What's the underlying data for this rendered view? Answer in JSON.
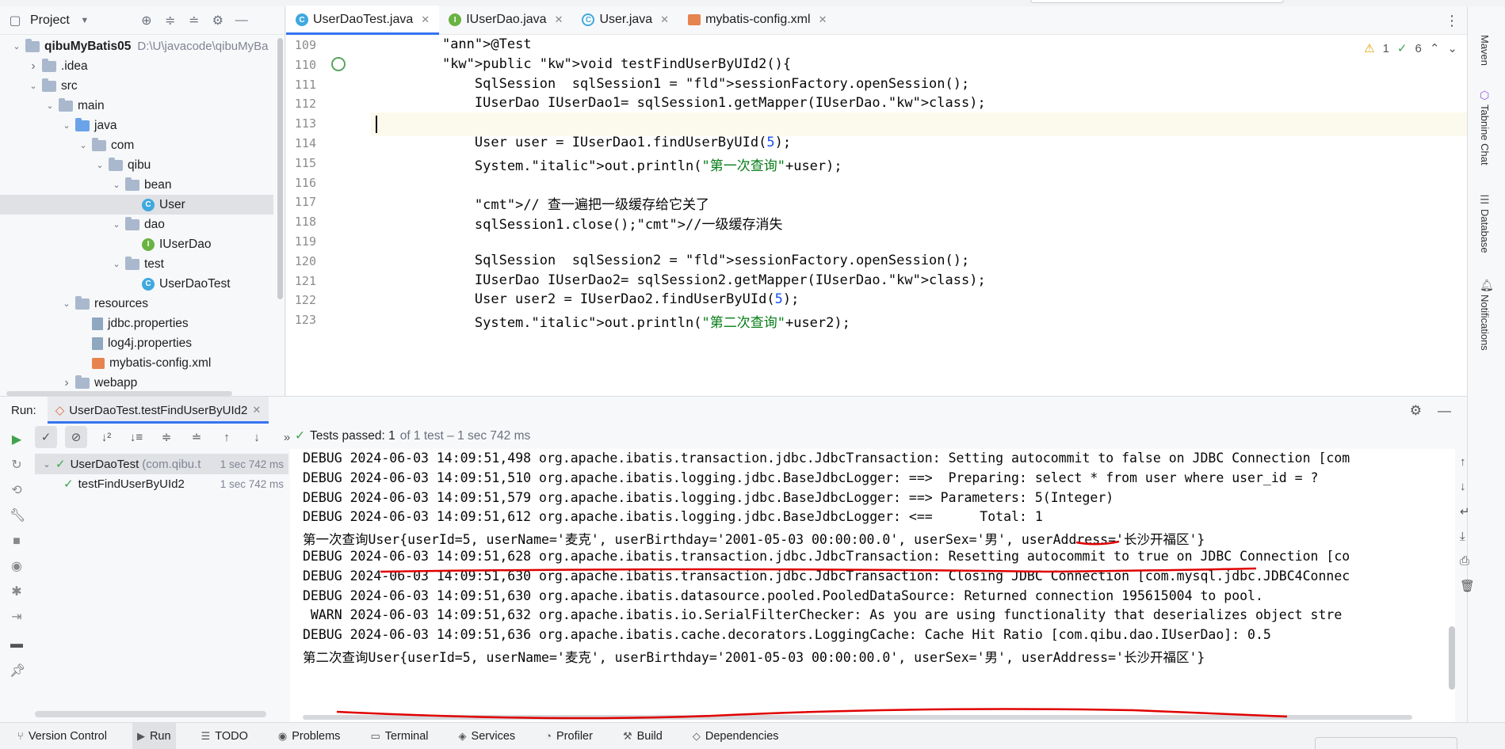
{
  "project": {
    "title": "Project",
    "tree": [
      {
        "label": "qibuMyBatis05",
        "path": "D:\\U\\javacode\\qibuMyBa",
        "icon": "module",
        "depth": 0,
        "open": true
      },
      {
        "label": ".idea",
        "icon": "folder",
        "depth": 1,
        "open": false
      },
      {
        "label": "src",
        "icon": "folder",
        "depth": 1,
        "open": true
      },
      {
        "label": "main",
        "icon": "folder",
        "depth": 2,
        "open": true
      },
      {
        "label": "java",
        "icon": "source-folder",
        "depth": 3,
        "open": true
      },
      {
        "label": "com",
        "icon": "package",
        "depth": 4,
        "open": true
      },
      {
        "label": "qibu",
        "icon": "package",
        "depth": 5,
        "open": true
      },
      {
        "label": "bean",
        "icon": "package",
        "depth": 6,
        "open": true
      },
      {
        "label": "User",
        "icon": "class",
        "depth": 7
      },
      {
        "label": "dao",
        "icon": "package",
        "depth": 6,
        "open": true
      },
      {
        "label": "IUserDao",
        "icon": "interface",
        "depth": 7
      },
      {
        "label": "test",
        "icon": "package",
        "depth": 6,
        "open": true
      },
      {
        "label": "UserDaoTest",
        "icon": "test-class",
        "depth": 7
      },
      {
        "label": "resources",
        "icon": "resources-folder",
        "depth": 3,
        "open": true
      },
      {
        "label": "jdbc.properties",
        "icon": "properties",
        "depth": 4
      },
      {
        "label": "log4j.properties",
        "icon": "properties",
        "depth": 4
      },
      {
        "label": "mybatis-config.xml",
        "icon": "xml",
        "depth": 4
      },
      {
        "label": "webapp",
        "icon": "folder",
        "depth": 3,
        "open": false
      }
    ]
  },
  "editor": {
    "tabs": [
      {
        "label": "UserDaoTest.java",
        "icon": "test-class",
        "active": true
      },
      {
        "label": "IUserDao.java",
        "icon": "interface",
        "active": false
      },
      {
        "label": "User.java",
        "icon": "class",
        "active": false
      },
      {
        "label": "mybatis-config.xml",
        "icon": "xml",
        "active": false
      }
    ],
    "warnings": "1",
    "checks": "6",
    "lines": [
      {
        "n": "109",
        "code": "    @Test"
      },
      {
        "n": "110",
        "code": "    public void testFindUserByUId2(){"
      },
      {
        "n": "111",
        "code": "        SqlSession  sqlSession1 = sessionFactory.openSession();"
      },
      {
        "n": "112",
        "code": "        IUserDao IUserDao1= sqlSession1.getMapper(IUserDao.class);"
      },
      {
        "n": "113",
        "code": ""
      },
      {
        "n": "114",
        "code": "        User user = IUserDao1.findUserByUId(5);"
      },
      {
        "n": "115",
        "code": "        System.out.println(\"第一次查询\"+user);"
      },
      {
        "n": "116",
        "code": ""
      },
      {
        "n": "117",
        "code": "        // 查一遍把一级缓存给它关了"
      },
      {
        "n": "118",
        "code": "        sqlSession1.close();//一级缓存消失"
      },
      {
        "n": "119",
        "code": ""
      },
      {
        "n": "120",
        "code": "        SqlSession  sqlSession2 = sessionFactory.openSession();"
      },
      {
        "n": "121",
        "code": "        IUserDao IUserDao2= sqlSession2.getMapper(IUserDao.class);"
      },
      {
        "n": "122",
        "code": "        User user2 = IUserDao2.findUserByUId(5);"
      },
      {
        "n": "123",
        "code": "        System.out.println(\"第二次查询\"+user2);"
      }
    ]
  },
  "right_strip": [
    "Maven",
    "Tabnine Chat",
    "Database",
    "Notifications"
  ],
  "run": {
    "label": "Run:",
    "tab": "UserDaoTest.testFindUserByUId2",
    "status_bold": "Tests passed: 1",
    "status_rest": "of 1 test – 1 sec 742 ms",
    "tests": [
      {
        "label": "UserDaoTest",
        "detail": "(com.qibu.t",
        "time": "1 sec 742 ms",
        "depth": 0
      },
      {
        "label": "testFindUserByUId2",
        "detail": "",
        "time": "1 sec 742 ms",
        "depth": 1
      }
    ],
    "console": [
      "DEBUG 2024-06-03 14:09:51,498 org.apache.ibatis.transaction.jdbc.JdbcTransaction: Setting autocommit to false on JDBC Connection [com",
      "DEBUG 2024-06-03 14:09:51,510 org.apache.ibatis.logging.jdbc.BaseJdbcLogger: ==>  Preparing: select * from user where user_id = ?",
      "DEBUG 2024-06-03 14:09:51,579 org.apache.ibatis.logging.jdbc.BaseJdbcLogger: ==> Parameters: 5(Integer)",
      "DEBUG 2024-06-03 14:09:51,612 org.apache.ibatis.logging.jdbc.BaseJdbcLogger: <==      Total: 1",
      "第一次查询User{userId=5, userName='麦克', userBirthday='2001-05-03 00:00:00.0', userSex='男', userAddress='长沙开福区'}",
      "DEBUG 2024-06-03 14:09:51,628 org.apache.ibatis.transaction.jdbc.JdbcTransaction: Resetting autocommit to true on JDBC Connection [co",
      "DEBUG 2024-06-03 14:09:51,630 org.apache.ibatis.transaction.jdbc.JdbcTransaction: Closing JDBC Connection [com.mysql.jdbc.JDBC4Connec",
      "DEBUG 2024-06-03 14:09:51,630 org.apache.ibatis.datasource.pooled.PooledDataSource: Returned connection 195615004 to pool.",
      " WARN 2024-06-03 14:09:51,632 org.apache.ibatis.io.SerialFilterChecker: As you are using functionality that deserializes object stre",
      "DEBUG 2024-06-03 14:09:51,636 org.apache.ibatis.cache.decorators.LoggingCache: Cache Hit Ratio [com.qibu.dao.IUserDao]: 0.5",
      "第二次查询User{userId=5, userName='麦克', userBirthday='2001-05-03 00:00:00.0', userSex='男', userAddress='长沙开福区'}"
    ]
  },
  "status_bar": [
    {
      "label": "Version Control",
      "icon": "branch-icon",
      "active": false
    },
    {
      "label": "Run",
      "icon": "run-icon",
      "active": true
    },
    {
      "label": "TODO",
      "icon": "list-icon",
      "active": false
    },
    {
      "label": "Problems",
      "icon": "problems-icon",
      "active": false
    },
    {
      "label": "Terminal",
      "icon": "terminal-icon",
      "active": false
    },
    {
      "label": "Services",
      "icon": "services-icon",
      "active": false
    },
    {
      "label": "Profiler",
      "icon": "profiler-icon",
      "active": false
    },
    {
      "label": "Build",
      "icon": "build-icon",
      "active": false
    },
    {
      "label": "Dependencies",
      "icon": "dependencies-icon",
      "active": false
    }
  ],
  "colors": {
    "accent": "#3574f0",
    "annotation": "#e00000",
    "pass": "#3fa34d"
  }
}
